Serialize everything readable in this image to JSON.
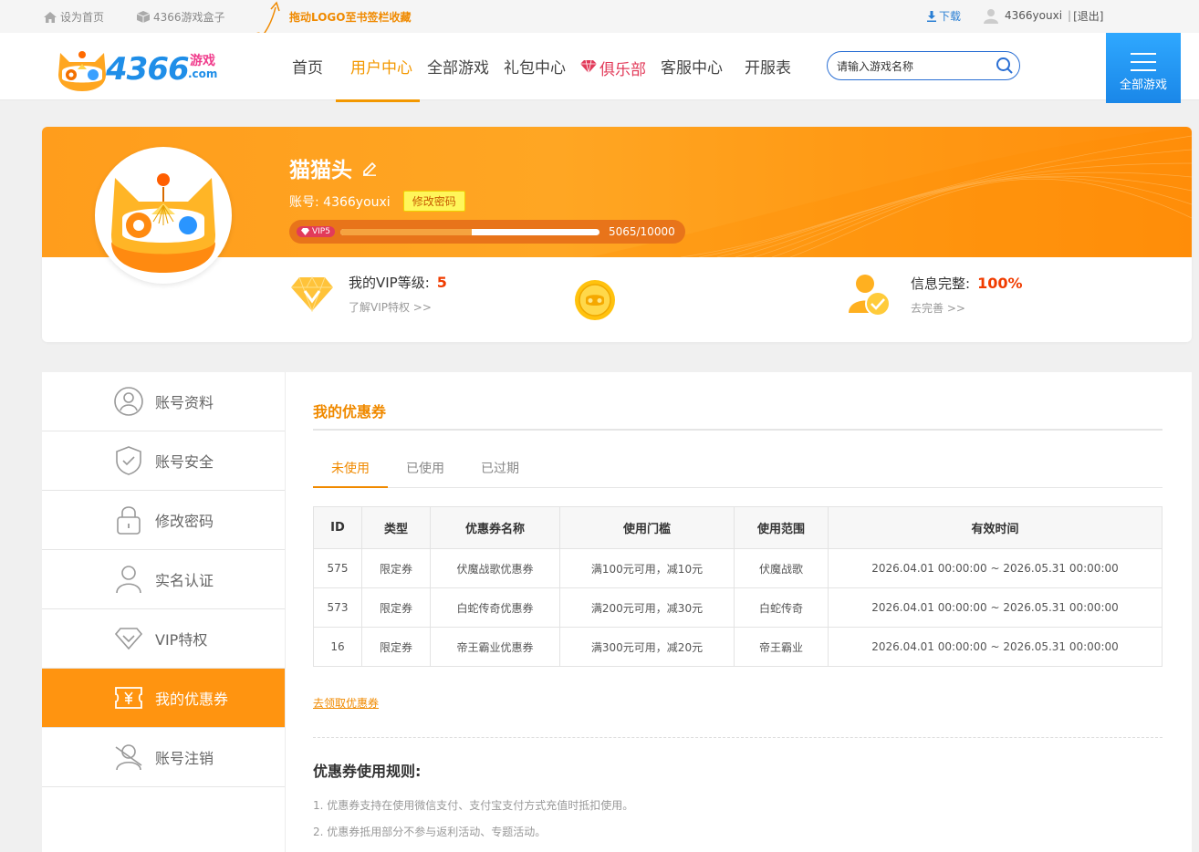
{
  "topbar": {
    "set_home": "设为首页",
    "game_box": "4366游戏盒子",
    "drag_tip": "拖动LOGO至书签栏收藏",
    "download": "下载",
    "username": "4366youxi",
    "logout": "[退出]"
  },
  "header": {
    "logo_text": "4366",
    "logo_sub": "游戏",
    "logo_com": ".com",
    "nav": [
      "首页",
      "用户中心",
      "全部游戏",
      "礼包中心",
      "俱乐部",
      "客服中心",
      "开服表"
    ],
    "active_nav": "用户中心",
    "search_placeholder": "请输入游戏名称",
    "all_games": "全部游戏"
  },
  "profile": {
    "nickname": "猫猫头",
    "account_label": "账号:",
    "account": "4366youxi",
    "change_pwd": "修改密码",
    "vip_badge": "VIP5",
    "exp_current": 5065,
    "exp_total": 10000,
    "exp_text": "5065/10000",
    "vip_level_label": "我的VIP等级:",
    "vip_level": "5",
    "vip_link": "了解VIP特权 >>",
    "info_label": "信息完整:",
    "info_value": "100%",
    "info_link": "去完善 >>"
  },
  "sidebar": {
    "items": [
      {
        "label": "账号资料",
        "icon": "user-circle-icon"
      },
      {
        "label": "账号安全",
        "icon": "shield-icon"
      },
      {
        "label": "修改密码",
        "icon": "lock-icon"
      },
      {
        "label": "实名认证",
        "icon": "person-icon"
      },
      {
        "label": "VIP特权",
        "icon": "diamond-icon"
      },
      {
        "label": "我的优惠券",
        "icon": "coupon-icon"
      },
      {
        "label": "账号注销",
        "icon": "user-cancel-icon"
      }
    ],
    "active_index": 5
  },
  "main": {
    "title": "我的优惠券",
    "tabs": [
      "未使用",
      "已使用",
      "已过期"
    ],
    "active_tab": 0,
    "table": {
      "headers": [
        "ID",
        "类型",
        "优惠券名称",
        "使用门槛",
        "使用范围",
        "有效时间"
      ],
      "rows": [
        [
          "575",
          "限定券",
          "伏魔战歌优惠券",
          "满100元可用，减10元",
          "伏魔战歌",
          "2026.04.01 00:00:00 ~ 2026.05.31 00:00:00"
        ],
        [
          "573",
          "限定券",
          "白蛇传奇优惠券",
          "满200元可用，减30元",
          "白蛇传奇",
          "2026.04.01 00:00:00 ~ 2026.05.31 00:00:00"
        ],
        [
          "16",
          "限定券",
          "帝王霸业优惠券",
          "满300元可用，减20元",
          "帝王霸业",
          "2026.04.01 00:00:00 ~ 2026.05.31 00:00:00"
        ]
      ]
    },
    "get_coupon_link": "去领取优惠券",
    "rules_title": "优惠券使用规则:",
    "rules": [
      "1. 优惠券支持在使用微信支付、支付宝支付方式充值时抵扣使用。",
      "2. 优惠券抵用部分不参与返利活动、专题活动。"
    ]
  },
  "colors": {
    "accent": "#f39800",
    "banner": "#ffa623",
    "link_blue": "#2a7fd4",
    "club_red": "#e23b5a"
  }
}
